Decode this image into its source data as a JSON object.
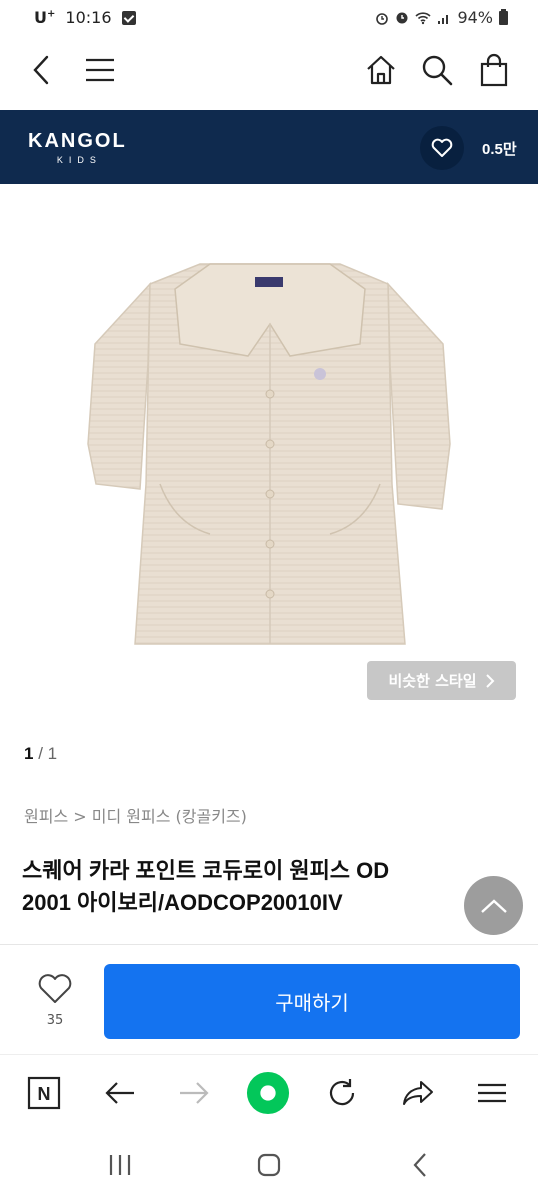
{
  "status_bar": {
    "carrier": "U",
    "carrier_sup": "+",
    "time": "10:16",
    "battery": "94%"
  },
  "top_nav": {
    "icons": [
      "back-icon",
      "menu-icon",
      "home-icon",
      "search-icon",
      "shopping-bag-icon"
    ]
  },
  "brand": {
    "name": "KANGOL",
    "sub": "KIDS",
    "likes": "0.5만",
    "background": "#0f2a4e"
  },
  "gallery": {
    "similar_style": "비슷한 스타일",
    "current_page": "1",
    "separator": " / ",
    "total_pages": "1"
  },
  "product": {
    "breadcrumb": "원피스 > 미디 원피스 (캉골키즈)",
    "title_line1": "스퀘어 카라 포인트 코듀로이 원피스 OD",
    "title_line2": "2001 아이보리/AODCOP20010IV"
  },
  "purchase": {
    "wish_count": "35",
    "buy_label": "구매하기",
    "accent": "#1473f0"
  },
  "browser_toolbar": {
    "n_label": "N",
    "icons": [
      "n-icon",
      "back-arrow-icon",
      "forward-arrow-icon",
      "green-dot-icon",
      "refresh-icon",
      "share-icon",
      "menu-icon"
    ]
  }
}
